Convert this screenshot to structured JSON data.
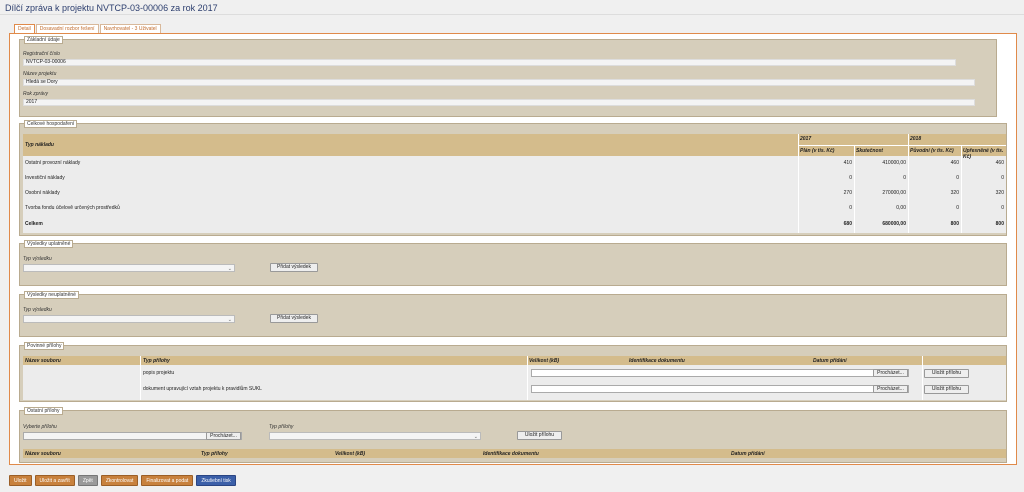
{
  "page": {
    "title": "Dílčí zpráva k projektu NVTCP-03-00006 za rok 2017"
  },
  "tabs": [
    "Detail",
    "Dosavadní rozbor řešení",
    "Navrhovatel - 3 Uživatel"
  ],
  "basic": {
    "legend": "Základní údaje",
    "reg_label": "Registrační číslo",
    "reg_value": "NVTCP-03-00006",
    "name_label": "Název projektu",
    "name_value": "Hledá se Dory",
    "year_label": "Rok zprávy",
    "year_value": "2017"
  },
  "finance": {
    "legend": "Celkové hospodaření",
    "col_type": "Typ nákladu",
    "year1": "2017",
    "year2": "2018",
    "sub": [
      "Plán (v tis. Kč)",
      "Skutečnost",
      "Původní (v tis. Kč)",
      "Upřesněné (v tis. Kč)"
    ],
    "rows": [
      {
        "name": "Ostatní provozní náklady",
        "v": [
          "410",
          "410000,00",
          "460",
          "460"
        ]
      },
      {
        "name": "Investiční náklady",
        "v": [
          "0",
          "0",
          "0",
          "0"
        ]
      },
      {
        "name": "Osobní náklady",
        "v": [
          "270",
          "270000,00",
          "320",
          "320"
        ]
      },
      {
        "name": "Tvorba fondu účelově určených prostředků",
        "v": [
          "0",
          "0,00",
          "0",
          "0"
        ]
      }
    ],
    "total": {
      "name": "Celkem",
      "v": [
        "680",
        "680000,00",
        "800",
        "800"
      ]
    }
  },
  "results_applied": {
    "legend": "Výsledky uplatněné",
    "type_label": "Typ výsledku",
    "add_btn": "Přidat výsledek"
  },
  "results_unapplied": {
    "legend": "Výsledky neuplatněné",
    "type_label": "Typ výsledku",
    "add_btn": "Přidat výsledek"
  },
  "required": {
    "legend": "Povinné přílohy",
    "cols": [
      "Název souboru",
      "Typ přílohy",
      "Velikost (kB)",
      "Identifikace dokumentu",
      "Datum přidání"
    ],
    "rows": [
      {
        "type": "popis projektu",
        "browse": "Procházet...",
        "save": "Uložit přílohu"
      },
      {
        "type": "dokument upravující vztah projektu k pravidlům SUKL",
        "browse": "Procházet...",
        "save": "Uložit přílohu"
      }
    ]
  },
  "other": {
    "legend": "Ostatní přílohy",
    "choose_label": "Vyberte přílohu",
    "browse": "Procházet...",
    "type_label": "Typ přílohy",
    "save": "Uložit přílohu",
    "cols": [
      "Název souboru",
      "Typ přílohy",
      "Velikost (kB)",
      "Identifikace dokumentu",
      "Datum přidání"
    ]
  },
  "buttons": [
    "Uložit",
    "Uložit a zavřít",
    "Zpět",
    "Zkontrolovat",
    "Finalizovat a podat",
    "Zkušební tisk"
  ],
  "icons": {
    "select": "chevron-down-icon"
  }
}
